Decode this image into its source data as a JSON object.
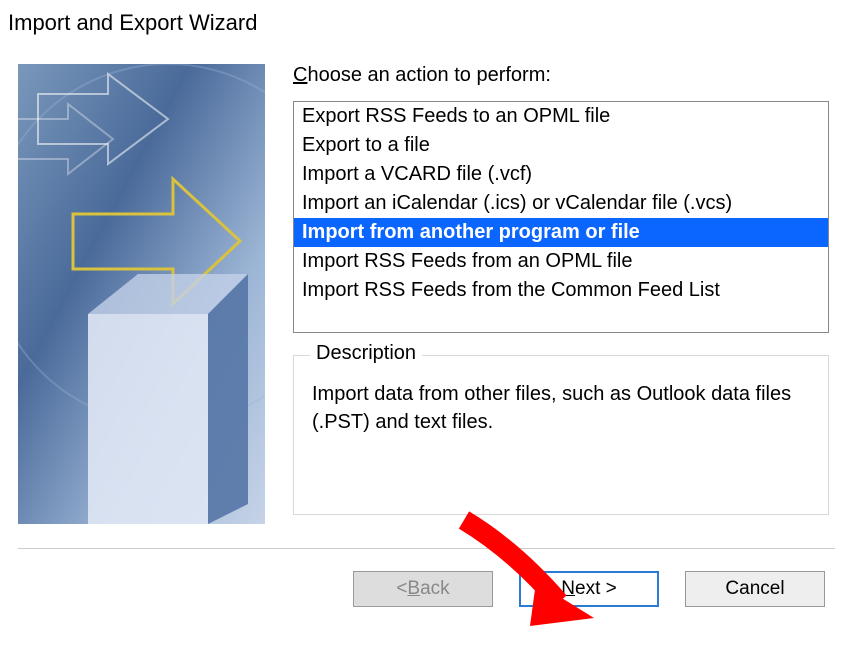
{
  "dialog": {
    "title": "Import and Export Wizard"
  },
  "prompt": {
    "label_pre": "C",
    "label_rest": "hoose an action to perform:"
  },
  "actions": {
    "items": [
      "Export RSS Feeds to an OPML file",
      "Export to a file",
      "Import a VCARD file (.vcf)",
      "Import an iCalendar (.ics) or vCalendar file (.vcs)",
      "Import from another program or file",
      "Import RSS Feeds from an OPML file",
      "Import RSS Feeds from the Common Feed List"
    ],
    "selected_index": 4
  },
  "description": {
    "legend": "Description",
    "text": "Import data from other files, such as Outlook data files (.PST) and text files."
  },
  "buttons": {
    "back_pre": "< ",
    "back_u": "B",
    "back_rest": "ack",
    "next_u": "N",
    "next_rest": "ext >",
    "cancel": "Cancel"
  }
}
